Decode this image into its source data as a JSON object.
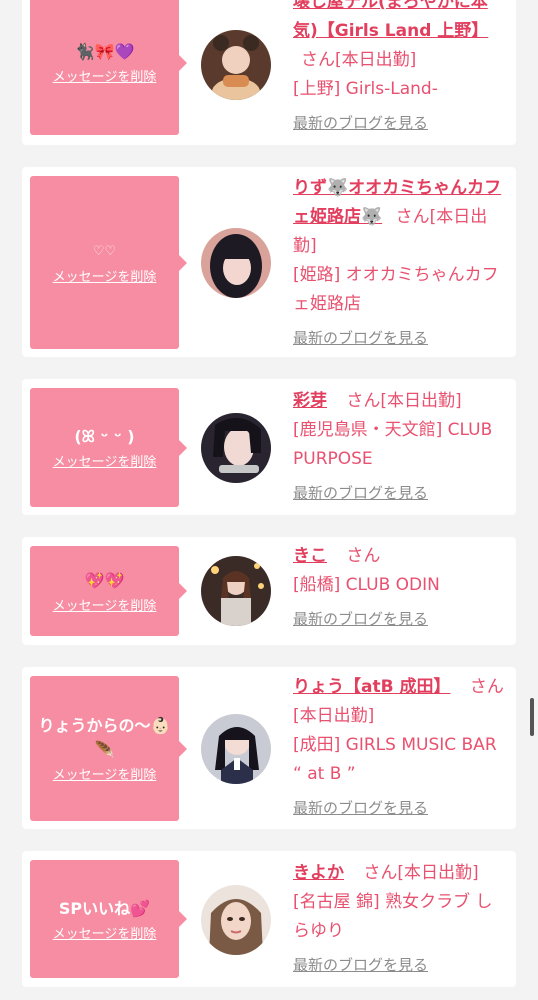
{
  "delete_label": "メッセージを削除",
  "blog_label": "最新のブログを見る",
  "honorific": "さん",
  "colors": {
    "accent": "#f78da2",
    "name": "#e23e5e",
    "text": "#e8516f",
    "link_gray": "#8c8c8c",
    "background": "#f3f3f3"
  },
  "cards": [
    {
      "message": "🐈‍⬛🎀💜",
      "name": "壊し屋テル(まろやかに本気)【Girls Land 上野】",
      "status": "[本日出勤]",
      "shop": "[上野] Girls-Land-"
    },
    {
      "message": "♡♡",
      "name": "りず🐺オオカミちゃんカフェ姫路店🐺",
      "status": "[本日出勤]",
      "shop": "[姫路] オオカミちゃんカフェ姫路店"
    },
    {
      "message": "(ꕤ ᵕ ᵕ )",
      "name": "彩芽",
      "status": "[本日出勤]",
      "shop": "[鹿児島県・天文館] CLUB PURPOSE"
    },
    {
      "message": "💖💖",
      "name": "きこ",
      "status": "",
      "shop": "[船橋] CLUB ODIN"
    },
    {
      "message": "りょうからの〜👶🏻🪶",
      "name": "りょう【atB 成田】",
      "status": "[本日出勤]",
      "shop": "[成田] GIRLS MUSIC BAR “ at B ”"
    },
    {
      "message": "SPいいね💕",
      "name": "きよか",
      "status": "[本日出勤]",
      "shop": "[名古屋 錦] 熟女クラブ しらゆり"
    }
  ]
}
